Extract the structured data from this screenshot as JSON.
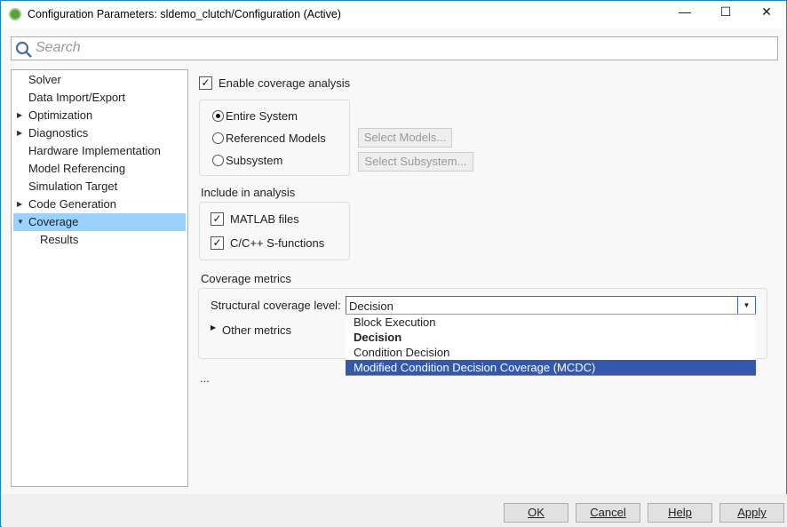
{
  "window": {
    "title": "Configuration Parameters: sldemo_clutch/Configuration (Active)",
    "minimize": "—",
    "maximize": "☐",
    "close": "✕"
  },
  "search": {
    "placeholder": "Search"
  },
  "tree": [
    {
      "label": "Solver",
      "expander": ""
    },
    {
      "label": "Data Import/Export",
      "expander": ""
    },
    {
      "label": "Optimization",
      "expander": "▶"
    },
    {
      "label": "Diagnostics",
      "expander": "▶"
    },
    {
      "label": "Hardware Implementation",
      "expander": ""
    },
    {
      "label": "Model Referencing",
      "expander": ""
    },
    {
      "label": "Simulation Target",
      "expander": ""
    },
    {
      "label": "Code Generation",
      "expander": "▶"
    },
    {
      "label": "Coverage",
      "expander": "▼"
    },
    {
      "label": "Results",
      "expander": ""
    }
  ],
  "main": {
    "enable_label": "Enable coverage analysis",
    "check": "✓",
    "scope": [
      "Entire System",
      "Referenced Models",
      "Subsystem"
    ],
    "select_models": "Select Models...",
    "select_subsystem": "Select Subsystem...",
    "include_heading": "Include in analysis",
    "include": [
      "MATLAB files",
      "C/C++ S-functions"
    ],
    "metrics_heading": "Coverage metrics",
    "structural_label": "Structural coverage level:",
    "structural_value": "Decision",
    "options": [
      "Block Execution",
      "Decision",
      "Condition Decision",
      "Modified Condition Decision Coverage (MCDC)"
    ],
    "other_metrics": "Other metrics",
    "ellipsis": "..."
  },
  "footer": {
    "ok": "OK",
    "cancel": "Cancel",
    "help": "Help",
    "apply": "Apply"
  }
}
